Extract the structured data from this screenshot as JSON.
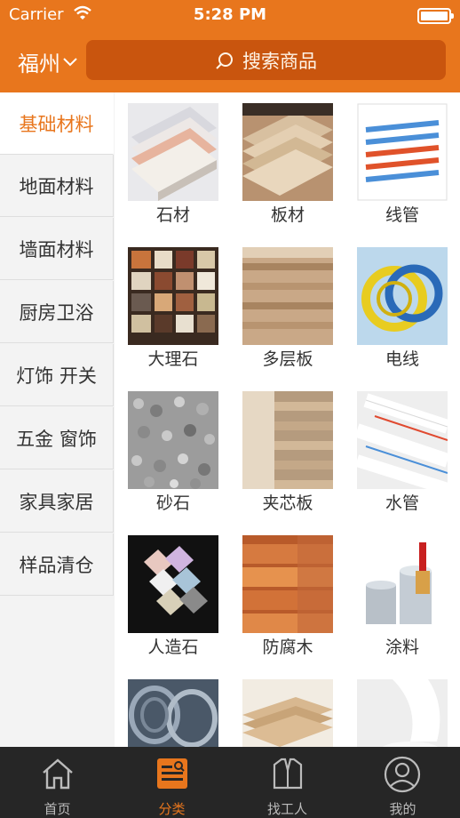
{
  "status_bar": {
    "carrier": "Carrier",
    "time": "5:28 PM"
  },
  "header": {
    "city": "福州",
    "search_placeholder": "搜索商品"
  },
  "sidebar": {
    "items": [
      "基础材料",
      "地面材料",
      "墙面材料",
      "厨房卫浴",
      "灯饰 开关",
      "五金 窗饰",
      "家具家居",
      "样品清仓"
    ],
    "active_index": 0
  },
  "products": [
    {
      "label": "石材",
      "icon": "stone-slabs"
    },
    {
      "label": "板材",
      "icon": "wood-boards"
    },
    {
      "label": "线管",
      "icon": "conduit-pipes"
    },
    {
      "label": "大理石",
      "icon": "marble-tiles"
    },
    {
      "label": "多层板",
      "icon": "plywood"
    },
    {
      "label": "电线",
      "icon": "electric-wire"
    },
    {
      "label": "砂石",
      "icon": "gravel"
    },
    {
      "label": "夹芯板",
      "icon": "blockboard"
    },
    {
      "label": "水管",
      "icon": "water-pipes"
    },
    {
      "label": "人造石",
      "icon": "artificial-stone"
    },
    {
      "label": "防腐木",
      "icon": "treated-wood"
    },
    {
      "label": "涂料",
      "icon": "paint-cans"
    },
    {
      "label": "",
      "icon": "steel-wire"
    },
    {
      "label": "",
      "icon": "mdf-boards"
    },
    {
      "label": "",
      "icon": "white-paint"
    }
  ],
  "tabbar": {
    "items": [
      {
        "label": "首页",
        "icon": "home-icon"
      },
      {
        "label": "分类",
        "icon": "category-icon"
      },
      {
        "label": "找工人",
        "icon": "worker-vest-icon"
      },
      {
        "label": "我的",
        "icon": "profile-icon"
      }
    ],
    "active_index": 1
  },
  "colors": {
    "brand": "#e8761d",
    "tabbar": "#262626",
    "search_bg": "#c9550e"
  }
}
